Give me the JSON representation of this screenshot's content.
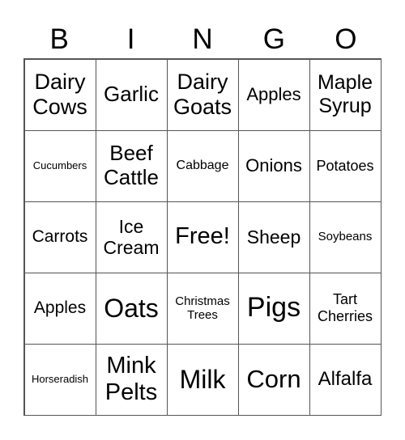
{
  "header": [
    "B",
    "I",
    "N",
    "G",
    "O"
  ],
  "cells": [
    "Dairy Cows",
    "Garlic",
    "Dairy Goats",
    "Apples",
    "Maple Syrup",
    "Cucumbers",
    "Beef Cattle",
    "Cabbage",
    "Onions",
    "Potatoes",
    "Carrots",
    "Ice Cream",
    "Free!",
    "Sheep",
    "Soybeans",
    "Apples",
    "Oats",
    "Christmas Trees",
    "Pigs",
    "Tart Cherries",
    "Horseradish",
    "Mink Pelts",
    "Milk",
    "Corn",
    "Alfalfa"
  ]
}
